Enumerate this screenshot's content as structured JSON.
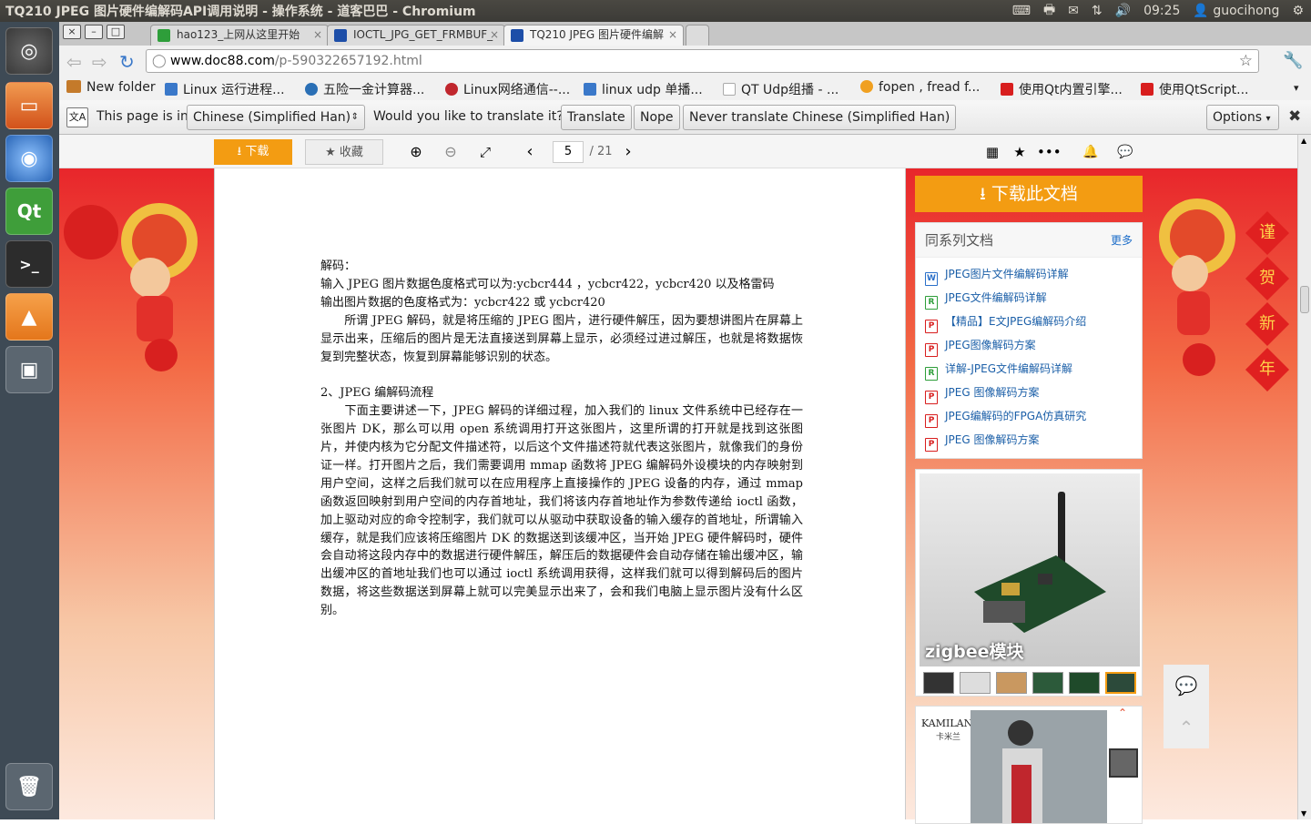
{
  "top_panel": {
    "window_title": "TQ210 JPEG 图片硬件编解码API调用说明 - 操作系统 - 道客巴巴 - Chromium",
    "clock": "09:25",
    "user": "guocihong"
  },
  "tabs": [
    {
      "label": "hao123_上网从这里开始",
      "color": "#2e9e3a"
    },
    {
      "label": "IOCTL_JPG_GET_FRMBUF_",
      "color": "#1d4ea8"
    },
    {
      "label": "TQ210 JPEG 图片硬件编解",
      "color": "#1d4ea8"
    }
  ],
  "window_controls": {
    "close": "×",
    "minimize": "–",
    "restore": "□"
  },
  "omnibox": {
    "host": "www.doc88.com",
    "path": "/p-590322657192.html"
  },
  "bookmarks": [
    {
      "label": "New folder",
      "color": "#c47a2a"
    },
    {
      "label": "Linux 运行进程...",
      "color": "#3a78c9"
    },
    {
      "label": "五险一金计算器...",
      "color": "#2a6fb5"
    },
    {
      "label": "Linux网络通信--...",
      "color": "#c0262d"
    },
    {
      "label": "linux udp 单播...",
      "color": "#3a78c9"
    },
    {
      "label": "QT Udp组播 - ...",
      "color": "#aaaaaa"
    },
    {
      "label": "fopen , fread f...",
      "color": "#f0a020"
    },
    {
      "label": "使用Qt内置引擎...",
      "color": "#d81e1e"
    },
    {
      "label": "使用QtScript...",
      "color": "#d81e1e"
    }
  ],
  "translate_bar": {
    "prompt": "This page is in",
    "language": "Chinese (Simplified Han)",
    "question": "Would you like to translate it?",
    "translate_label": "Translate",
    "nope_label": "Nope",
    "never_label": "Never translate Chinese (Simplified Han)",
    "options_label": "Options"
  },
  "viewer_toolbar": {
    "download_label": "下载",
    "favorite_label": "收藏",
    "page_current": "5",
    "page_total": "/ 21"
  },
  "document": {
    "paragraphs": [
      "解码：",
      "输入 JPEG 图片数据色度格式可以为:ycbcr444 ，ycbcr422，ycbcr420 以及格雷码",
      "输出图片数据的色度格式为：ycbcr422 或 ycbcr420",
      "　　所谓 JPEG 解码，就是将压缩的 JPEG 图片，进行硬件解压，因为要想讲图片在屏幕上显示出来，压缩后的图片是无法直接送到屏幕上显示，必须经过进过解压，也就是将数据恢复到完整状态，恢复到屏幕能够识别的状态。",
      "",
      "2、JPEG 编解码流程",
      "　　下面主要讲述一下，JPEG 解码的详细过程，加入我们的 linux 文件系统中已经存在一张图片 DK，那么可以用 open 系统调用打开这张图片，这里所谓的打开就是找到这张图片，并使内核为它分配文件描述符，以后这个文件描述符就代表这张图片，就像我们的身份证一样。打开图片之后，我们需要调用 mmap 函数将 JPEG 编解码外设模块的内存映射到用户空间，这样之后我们就可以在应用程序上直接操作的 JPEG 设备的内存，通过 mmap 函数返回映射到用户空间的内存首地址，我们将该内存首地址作为参数传递给 ioctl 函数，加上驱动对应的命令控制字，我们就可以从驱动中获取设备的输入缓存的首地址，所谓输入缓存，就是我们应该将压缩图片 DK 的数据送到该缓冲区，当开始 JPEG 硬件解码时，硬件会自动将这段内存中的数据进行硬件解压，解压后的数据硬件会自动存储在输出缓冲区，输出缓冲区的首地址我们也可以通过 ioctl 系统调用获得，这样我们就可以得到解码后的图片数据，将这些数据送到屏幕上就可以完美显示出来了，会和我们电脑上显示图片没有什么区别。"
    ]
  },
  "sidebar": {
    "download_doc_label": "下载此文档",
    "series_title": "同系列文档",
    "more_label": "更多",
    "series_items": [
      {
        "label": "JPEG图片文件编解码详解",
        "type": "W",
        "color": "#2a6fc9"
      },
      {
        "label": "JPEG文件编解码详解",
        "type": "R",
        "color": "#2e9e3a"
      },
      {
        "label": "【精品】E文JPEG编解码介绍",
        "type": "P",
        "color": "#d81e1e"
      },
      {
        "label": "JPEG图像解码方案",
        "type": "P",
        "color": "#d81e1e"
      },
      {
        "label": "详解-JPEG文件编解码详解",
        "type": "R",
        "color": "#2e9e3a"
      },
      {
        "label": "JPEG 图像解码方案",
        "type": "P",
        "color": "#d81e1e"
      },
      {
        "label": "JPEG编解码的FPGA仿真研究",
        "type": "P",
        "color": "#d81e1e"
      },
      {
        "label": "JPEG 图像解码方案",
        "type": "P",
        "color": "#d81e1e"
      }
    ],
    "ad_caption": "zigbee模块",
    "ad2_brand": "KAMILAN",
    "ad2_sub": "卡米兰"
  },
  "decor": {
    "chinese_new_year": [
      "谨",
      "贺",
      "新",
      "年"
    ]
  },
  "colors": {
    "accent_orange": "#f39c12",
    "link_blue": "#1b5fa8"
  }
}
